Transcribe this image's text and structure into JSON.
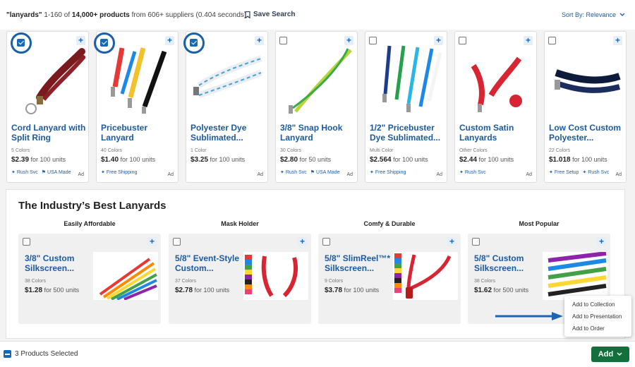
{
  "search": {
    "query": "\"lanyards\"",
    "range": "1-160 of",
    "count": "14,000+ products",
    "rest": "from 606+ suppliers (0.404 seconds)",
    "save_label": "Save Search",
    "sort_label": "Sort By: Relevance"
  },
  "products": [
    {
      "name": "Cord Lanyard with Split Ring",
      "colors": "5 Colors",
      "price": "$2.39",
      "units": "for 100 units",
      "tags": [
        "Rush Svc",
        "USA Made"
      ],
      "ad": "Ad",
      "checked": true
    },
    {
      "name": "Pricebuster Lanyard",
      "colors": "40 Colors",
      "price": "$1.40",
      "units": "for 100 units",
      "tags": [
        "Free Shipping"
      ],
      "ad": "Ad",
      "checked": true
    },
    {
      "name": "Polyester Dye Sublimated...",
      "colors": "1 Color",
      "price": "$3.25",
      "units": "for 100 units",
      "tags": [],
      "ad": "Ad",
      "checked": true
    },
    {
      "name": "3/8\" Snap Hook Lanyard",
      "colors": "30 Colors",
      "price": "$2.80",
      "units": "for 50 units",
      "tags": [
        "Rush Svc",
        "USA Made"
      ],
      "ad": "Ad",
      "checked": false
    },
    {
      "name": "1/2\" Pricebuster Dye Sublimated...",
      "colors": "Multi Color",
      "price": "$2.564",
      "units": "for 100 units",
      "tags": [
        "Free Shipping"
      ],
      "ad": "Ad",
      "checked": false
    },
    {
      "name": "Custom Satin Lanyards",
      "colors": "Other Colors",
      "price": "$2.44",
      "units": "for 100 units",
      "tags": [
        "Rush Svc"
      ],
      "ad": "Ad",
      "checked": false
    },
    {
      "name": "Low Cost Custom Polyester...",
      "colors": "22 Colors",
      "price": "$1.018",
      "units": "for 100 units",
      "tags": [
        "Free Setup",
        "Rush Svc"
      ],
      "ad": "Ad",
      "checked": false
    }
  ],
  "section": {
    "title": "The Industry’s Best Lanyards",
    "categories": [
      "Easily Affordable",
      "Mask Holder",
      "Comfy & Durable",
      "Most Popular"
    ],
    "items": [
      {
        "name": "3/8\" Custom Silkscreen...",
        "colors": "38 Colors",
        "price": "$1.28",
        "units": "for 500 units"
      },
      {
        "name": "5/8\" Event-Style Custom...",
        "colors": "37 Colors",
        "price": "$2.78",
        "units": "for 100 units"
      },
      {
        "name": "5/8\" SlimReel™* Silkscreen...",
        "colors": "9 Colors",
        "price": "$3.78",
        "units": "for 100 units"
      },
      {
        "name": "5/8\" Custom Silkscreen...",
        "colors": "38 Colors",
        "price": "$1.62",
        "units": "for 500 units"
      }
    ]
  },
  "footer": {
    "selected_label": "3 Products Selected",
    "add_label": "Add"
  },
  "menu": [
    "Add to Collection",
    "Add to Presentation",
    "Add to Order"
  ],
  "colors": {
    "brand_blue": "#1b5aa0",
    "add_green": "#13703d",
    "checked_blue": "#1668b8"
  }
}
